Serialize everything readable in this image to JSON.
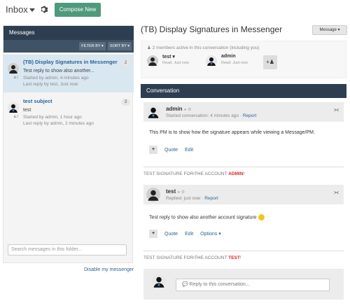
{
  "topbar": {
    "inbox_label": "Inbox",
    "compose_label": "Compose New"
  },
  "sidebar": {
    "header": "Messages",
    "filter_label": "FILTER BY ▾",
    "sort_label": "SORT BY ▾",
    "conversations": [
      {
        "title": "(TB) Display Signatures in Messenger",
        "preview": "Test reply to show also another...",
        "started": "Started by admin, 4 minutes ago",
        "last_reply": "Last reply by test, Just now",
        "count": "2",
        "participants": "2"
      },
      {
        "title": "test subject",
        "preview": "test",
        "started": "Started by admin, 1 hour ago",
        "last_reply": "Last reply by admin, 2 minutes ago",
        "count": "3",
        "participants": "2"
      }
    ],
    "search_placeholder": "Search messages in this folder...",
    "disable_link": "Disable my messenger"
  },
  "conversation": {
    "title": "(TB) Display Signatures in Messenger",
    "message_button": "Message ▾",
    "members_text": "2 members active in this conversation (including you)",
    "members": [
      {
        "name": "test ▾",
        "read": "Read: Just now"
      },
      {
        "name": "admin",
        "read": "Read: Just now"
      }
    ],
    "add_member": "+♟",
    "header": "Conversation",
    "posts": [
      {
        "name": "admin",
        "sub_prefix": "Started conversation: 4 minutes ago",
        "sub_link": "Report",
        "body": "This PM is to show how the signature appears while viewing a Message/PM.",
        "actions": [
          "Quote",
          "Edit"
        ],
        "sig_text": "TEST SIGNATURE FOR THE ACCOUNT ",
        "sig_name": "ADMIN",
        "sig_end": "!"
      },
      {
        "name": "test",
        "sub_prefix": "Replied: just now",
        "sub_link": "Report",
        "body": "Test reply to show also another account signature",
        "actions": [
          "Quote",
          "Edit",
          "Options ▾"
        ],
        "sig_text": "TEST SIGNATURE FOR THE ACCOUNT ",
        "sig_name": "TEST",
        "sig_end": "!"
      }
    ],
    "reply_placeholder": "Reply to this conversation..."
  },
  "colors": {
    "header_bg": "#2c3e50",
    "compose_bg": "#4e9a7c",
    "link": "#2a6496",
    "selected_row": "#d9e7f1",
    "sig_highlight": "#e0231f"
  }
}
